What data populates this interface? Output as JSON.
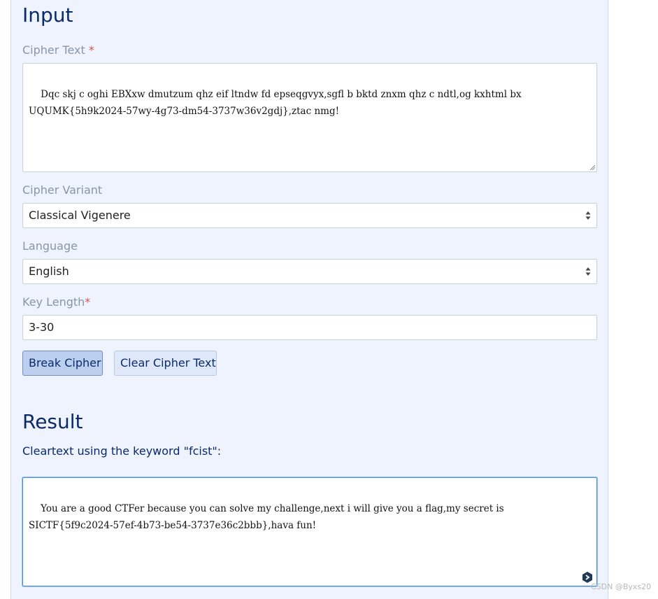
{
  "input_section": {
    "title": "Input",
    "cipher_text": {
      "label": "Cipher Text",
      "required_marker": "*",
      "value": "Dqc skj c oghi EBXxw dmutzum qhz eif ltndw fd epseqgvyx,sgfl b bktd znxm qhz c ndtl,og kxhtml bx UQUMK{5h9k2024-57wy-4g73-dm54-3737w36v2gdj},ztac nmg!"
    },
    "cipher_variant": {
      "label": "Cipher Variant",
      "selected": "Classical Vigenere"
    },
    "language": {
      "label": "Language",
      "selected": "English"
    },
    "key_length": {
      "label": "Key Length",
      "required_marker": "*",
      "value": "3-30"
    },
    "buttons": {
      "break": "Break Cipher",
      "clear": "Clear Cipher Text"
    }
  },
  "result_section": {
    "title": "Result",
    "cleartext_label": "Cleartext using the keyword \"fcist\":",
    "cleartext": "You are a good CTFer because you can solve my challenge,next i will give you a flag,my secret is SICTF{5f9c2024-57ef-4b73-be54-3737e36c2bbb},hava fun!"
  },
  "watermark": "CSDN @Byxs20",
  "colors": {
    "panel_bg": "#eef3fd",
    "heading": "#0a2a6b",
    "label_muted": "#8a95a8",
    "required": "#d9534f",
    "primary_button": "#bccfef",
    "focus_border": "#4a8be0"
  },
  "icons": {
    "select_arrows": "up-down-arrows-icon",
    "floating_action": "chevron-right-hex-icon"
  }
}
